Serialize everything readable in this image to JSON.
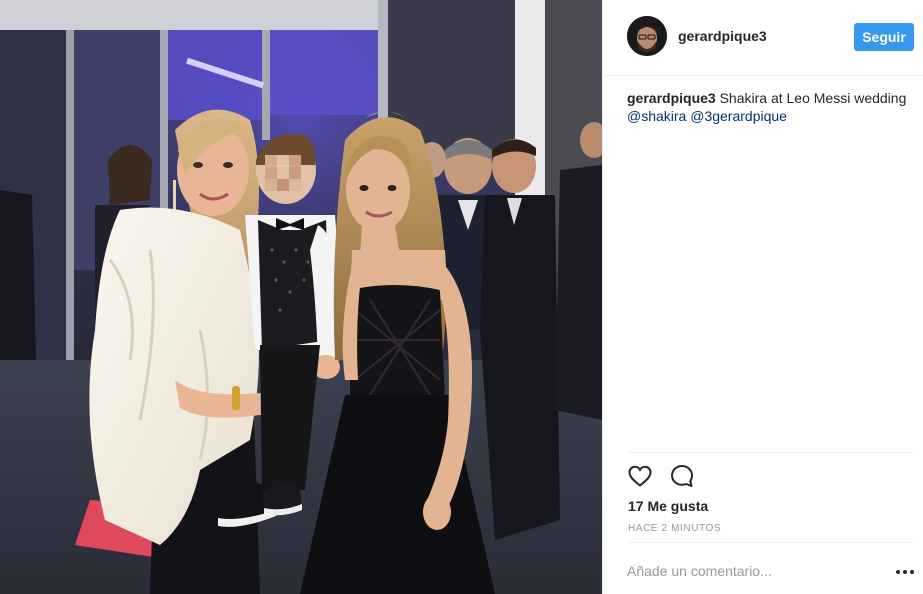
{
  "post": {
    "photo": {
      "alt": "Shakira at Leo Messi wedding photo"
    },
    "header": {
      "username": "gerardpique3",
      "follow_label": "Seguir"
    },
    "caption": {
      "username": "gerardpique3",
      "text": " Shakira at Leo Messi wedding ",
      "mention_1": "@shakira",
      "mention_2": "@3gerardpique"
    },
    "actions": {
      "like_icon": "heart-icon",
      "comment_icon": "comment-icon"
    },
    "likes": "17 Me gusta",
    "time": "HACE 2 MINUTOS",
    "comment": {
      "placeholder": "Añade un comentario...",
      "more_icon": "more-options-icon"
    }
  },
  "colors": {
    "accent": "#3897f0",
    "border": "#efefef",
    "text": "#262626",
    "muted": "#999999",
    "mention": "#003569"
  }
}
